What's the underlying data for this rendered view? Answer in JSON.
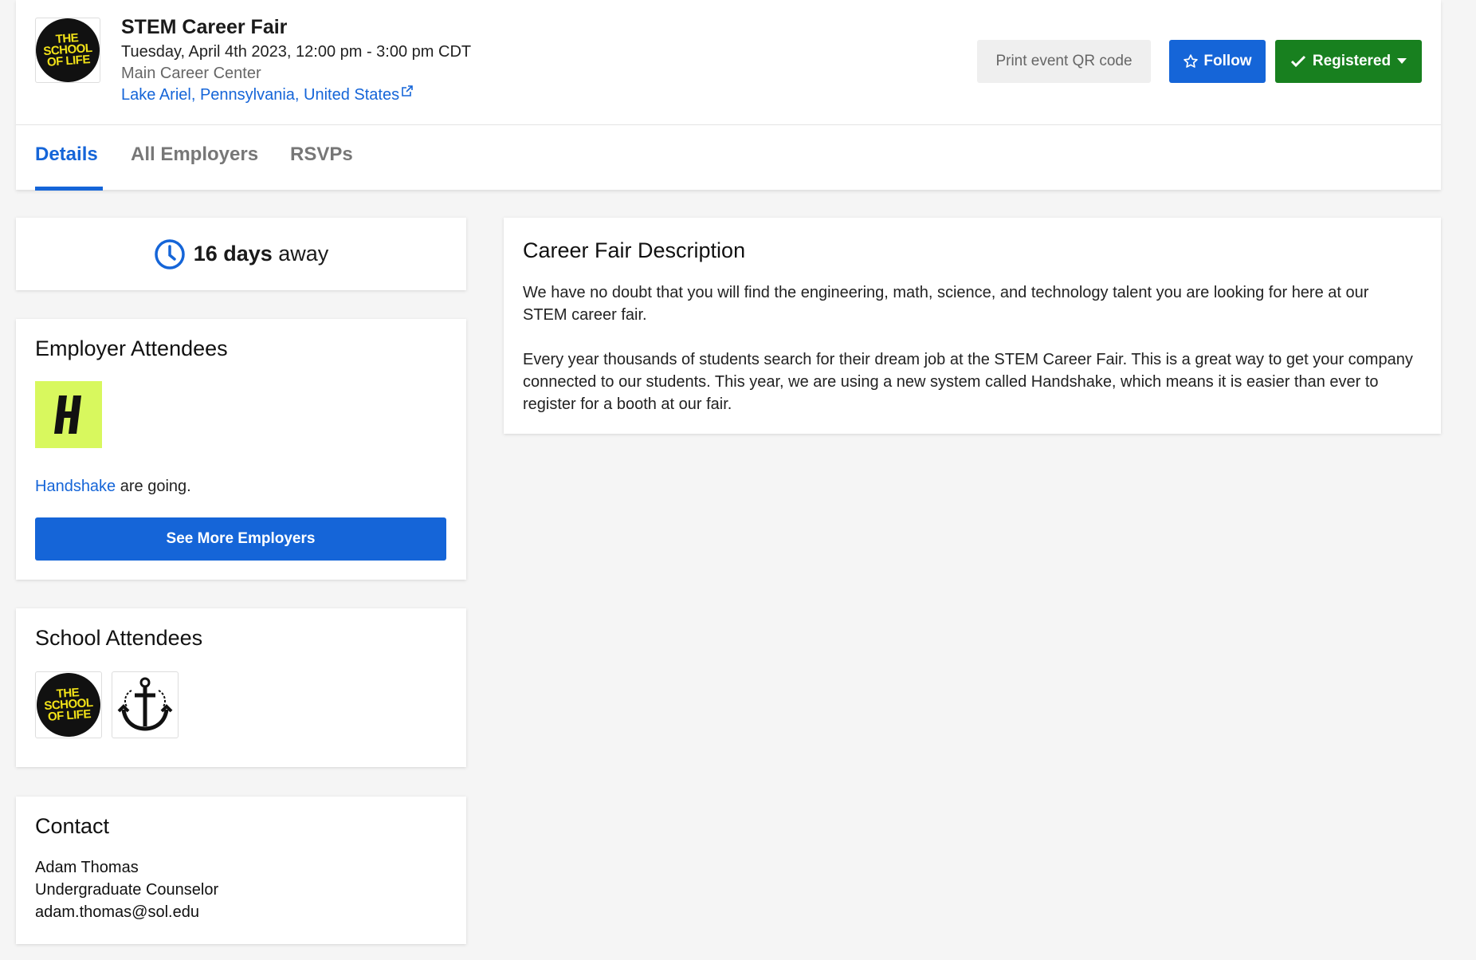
{
  "event": {
    "title": "STEM Career Fair",
    "datetime": "Tuesday, April 4th 2023, 12:00 pm - 3:00 pm CDT",
    "venue": "Main Career Center",
    "location": "Lake Ariel, Pennsylvania, United States",
    "logo_lines": [
      "THE",
      "SCHOOL",
      "OF LIFE"
    ]
  },
  "actions": {
    "print_qr": "Print event QR code",
    "follow": "Follow",
    "registered": "Registered"
  },
  "tabs": [
    {
      "label": "Details",
      "active": true
    },
    {
      "label": "All Employers",
      "active": false
    },
    {
      "label": "RSVPs",
      "active": false
    }
  ],
  "countdown": {
    "value": "16 days",
    "suffix": "away"
  },
  "employer_attendees": {
    "heading": "Employer Attendees",
    "link": "Handshake",
    "suffix": " are going.",
    "logo_letter": "H",
    "button": "See More Employers"
  },
  "school_attendees": {
    "heading": "School Attendees",
    "logos": [
      "THE SCHOOL OF LIFE",
      "anchor-logo"
    ]
  },
  "contact": {
    "heading": "Contact",
    "name": "Adam Thomas",
    "role": "Undergraduate Counselor",
    "email": "adam.thomas@sol.edu"
  },
  "description": {
    "heading": "Career Fair Description",
    "para1": "We have no doubt that you will find the engineering, math, science, and technology talent you are looking for here at our STEM career fair.",
    "para2": "Every year thousands of students search for their dream job at the STEM Career Fair. This is a great way to get your company connected to our students. This year, we are using a new system called Handshake, which means it is easier than ever to register for a booth at our fair."
  },
  "colors": {
    "primary_blue": "#1565d8",
    "success_green": "#18801f",
    "handshake_lime": "#d8f85e",
    "sol_yellow": "#f2e218"
  }
}
